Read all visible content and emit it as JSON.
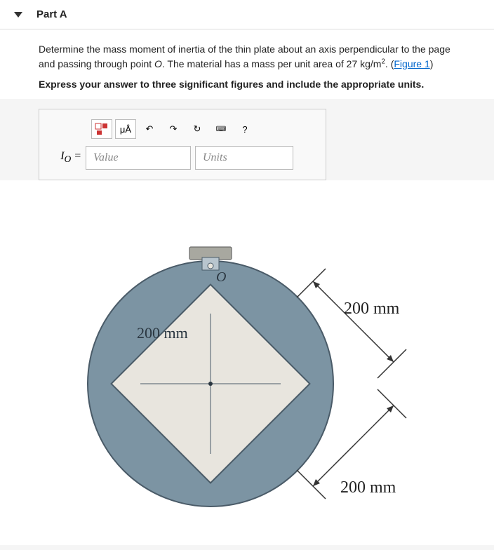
{
  "part": {
    "title": "Part A"
  },
  "question": {
    "line1_a": "Determine the mass moment of inertia of the thin plate about an axis perpendicular to the page and passing through point ",
    "point": "O",
    "line1_b": ". The material has a mass per unit area of 27 kg/m",
    "line1_c": ". (",
    "figure_link": "Figure 1",
    "line1_d": ")",
    "line2": "Express your answer to three significant figures and include the appropriate units."
  },
  "toolbar": {
    "template_icon": "⬚",
    "special_chars": "μÅ",
    "undo": "↶",
    "redo": "↷",
    "reset": "↻",
    "keyboard": "⌨",
    "help": "?"
  },
  "answer": {
    "label": "Iₒ =",
    "value_placeholder": "Value",
    "units_placeholder": "Units"
  },
  "figure": {
    "dim_top": "200 mm",
    "dim_left": "200 mm",
    "dim_bottom": "200 mm",
    "point_label": "O"
  }
}
